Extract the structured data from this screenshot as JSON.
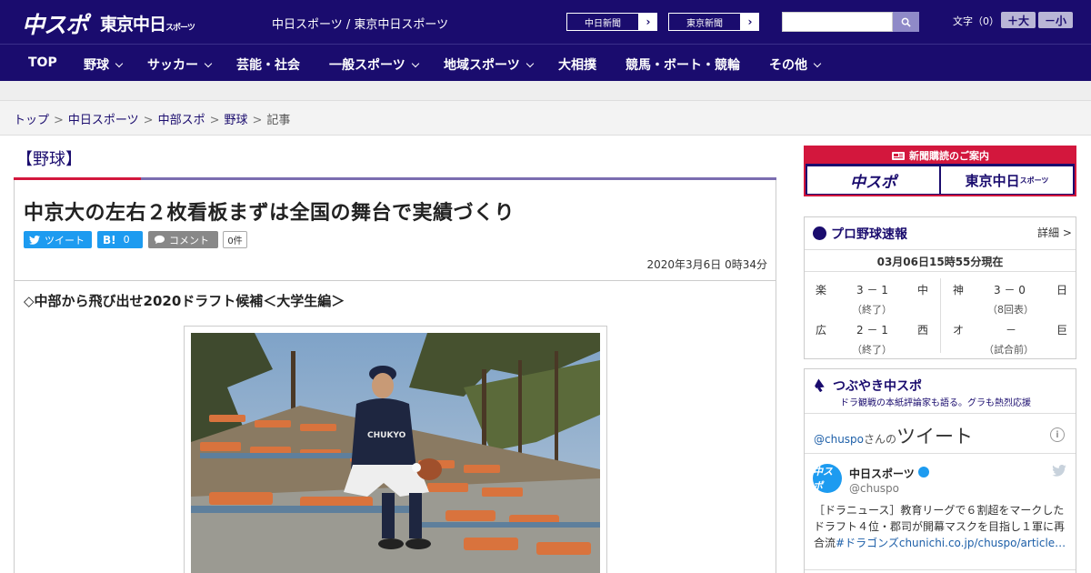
{
  "header": {
    "logo_main": "中スポ",
    "logo_tokyo": "東京中日",
    "logo_tokyo_small": "スポーツ",
    "site_links": "中日スポーツ / 東京中日スポーツ",
    "chunichi_shimbun": "中日新聞",
    "tokyo_shimbun": "東京新聞",
    "search_placeholder": "",
    "font_size_label": "文字（0）",
    "font_plus": "＋大",
    "font_minus": "－小"
  },
  "nav": {
    "items": [
      {
        "label": "TOP",
        "has_menu": false
      },
      {
        "label": "野球",
        "has_menu": true
      },
      {
        "label": "サッカー",
        "has_menu": true
      },
      {
        "label": "芸能・社会",
        "has_menu": false
      },
      {
        "label": "一般スポーツ",
        "has_menu": true
      },
      {
        "label": "地域スポーツ",
        "has_menu": true
      },
      {
        "label": "大相撲",
        "has_menu": false
      },
      {
        "label": "競馬・ボート・競輪",
        "has_menu": false
      },
      {
        "label": "その他",
        "has_menu": true
      }
    ]
  },
  "breadcrumb": {
    "items": [
      "トップ",
      "中日スポーツ",
      "中部スポ",
      "野球"
    ],
    "current": "記事",
    "separator": ">"
  },
  "article": {
    "category": "【野球】",
    "headline": "中京大の左右２枚看板まずは全国の舞台で実績づくり",
    "tweet_label": "ツイート",
    "hatena_label": "B!",
    "hatena_count": "0",
    "comment_label": "コメント",
    "comment_count": "0件",
    "date": "2020年3月6日 0時34分",
    "subhead": "◇中部から飛び出せ2020ドラフト候補＜大学生編＞",
    "photo_jersey_text": "CHUKYO"
  },
  "sidebar": {
    "ad": {
      "title": "新聞購読のご案内",
      "left": "中スポ",
      "right": "東京中日",
      "right_small": "スポーツ"
    },
    "baseball": {
      "title": "プロ野球速報",
      "detail": "詳細 >",
      "time": "03月06日15時55分現在",
      "games": [
        {
          "home": "楽",
          "score": "3 － 1",
          "away": "中",
          "status": "（終了）"
        },
        {
          "home": "神",
          "score": "3 － 0",
          "away": "日",
          "status": "（8回表）"
        },
        {
          "home": "広",
          "score": "2 － 1",
          "away": "西",
          "status": "（終了）"
        },
        {
          "home": "オ",
          "score": "－",
          "away": "巨",
          "status": "（試合前）"
        }
      ]
    },
    "tweets": {
      "title": "つぶやき中スポ",
      "subtitle": "ドラ観戦の本紙評論家も語る。グラも熱烈応援",
      "handle": "@chuspo",
      "handle_suffix": "さんの",
      "heading": "ツイート",
      "info": "i",
      "avatar_text": "中スポ",
      "name": "中日スポーツ",
      "id": "@chuspo",
      "text": "［ドラニュース］教育リーグで６割超をマークしたドラフト４位・郡司が開幕マスクを目指し１軍に再合流",
      "hashtag": "#ドラゴンズ",
      "link": "chunichi.co.jp/chuspo/article…"
    }
  },
  "colors": {
    "navy": "#1a0c6e",
    "red": "#d3173d",
    "twitter": "#1d9bf0"
  }
}
